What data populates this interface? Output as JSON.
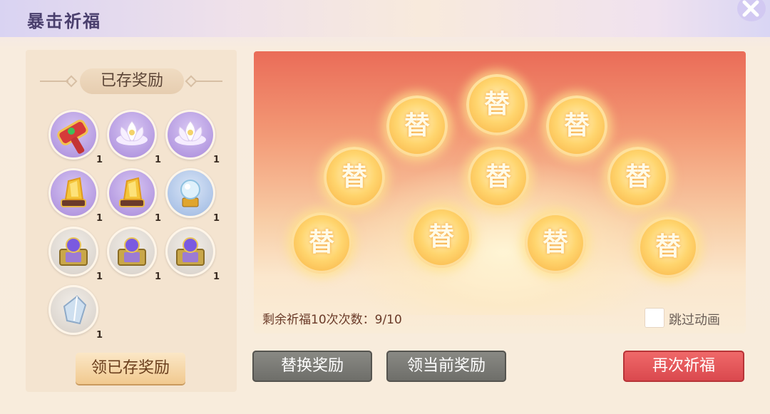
{
  "window": {
    "title": "暴击祈福",
    "close_icon": "close-icon"
  },
  "stored_panel": {
    "header": "已存奖励",
    "items": [
      {
        "icon": "hammer-icon",
        "count": "1",
        "frame": "purple"
      },
      {
        "icon": "lotus-icon",
        "count": "1",
        "frame": "purple"
      },
      {
        "icon": "lotus-icon",
        "count": "1",
        "frame": "purple"
      },
      {
        "icon": "crystal-icon",
        "count": "1",
        "frame": "purple"
      },
      {
        "icon": "crystal-icon",
        "count": "1",
        "frame": "purple"
      },
      {
        "icon": "orb-icon",
        "count": "1",
        "frame": "blue"
      },
      {
        "icon": "treasure-chest-icon",
        "count": "1",
        "frame": "gray"
      },
      {
        "icon": "treasure-chest-icon",
        "count": "1",
        "frame": "gray"
      },
      {
        "icon": "treasure-chest-icon",
        "count": "1",
        "frame": "gray"
      },
      {
        "icon": "ice-crystal-icon",
        "count": "1",
        "frame": "gray"
      }
    ],
    "claim_button": "领已存奖励"
  },
  "blessing_panel": {
    "coin_glyph": "替",
    "coins": [
      "替",
      "替",
      "替",
      "替",
      "替",
      "替",
      "替",
      "替",
      "替",
      "替"
    ],
    "remaining_text": "剩余祈福10次次数：9/10",
    "skip_label": "跳过动画"
  },
  "actions": {
    "replace": "替换奖励",
    "claim_current": "领当前奖励",
    "again": "再次祈福"
  }
}
